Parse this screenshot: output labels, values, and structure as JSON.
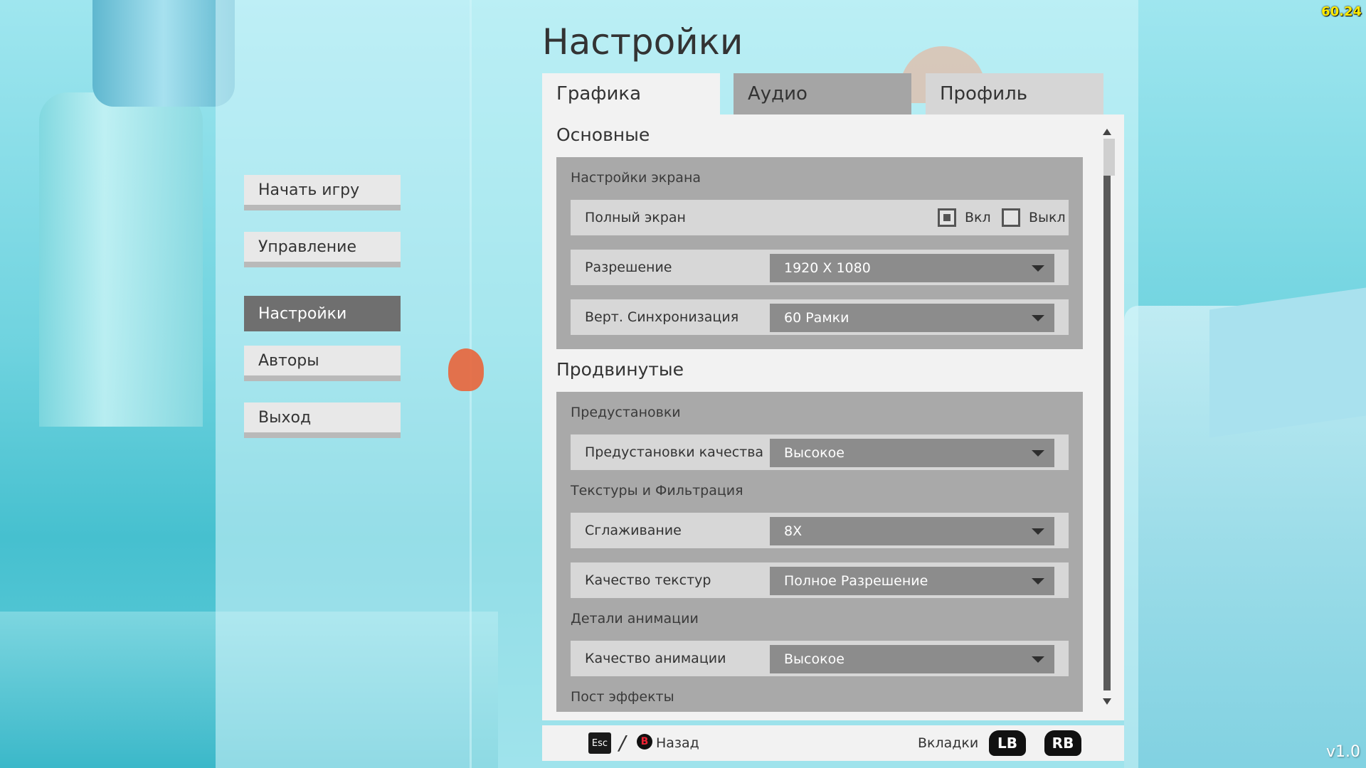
{
  "hud": {
    "fps": "60.24",
    "version": "v1.0"
  },
  "menu": {
    "items": [
      {
        "label": "Начать игру"
      },
      {
        "label": "Управление"
      },
      {
        "label": "Настройки"
      },
      {
        "label": "Авторы"
      },
      {
        "label": "Выход"
      }
    ],
    "active_index": 2
  },
  "settings": {
    "title": "Настройки",
    "tabs": [
      {
        "label": "Графика"
      },
      {
        "label": "Аудио"
      },
      {
        "label": "Профиль"
      }
    ],
    "active_tab": 0,
    "basic": {
      "title": "Основные",
      "screen_group": "Настройки экрана",
      "fullscreen": {
        "label": "Полный экран",
        "on_label": "Вкл",
        "off_label": "Выкл",
        "value": "on"
      },
      "resolution": {
        "label": "Разрешение",
        "value": "1920 X 1080"
      },
      "vsync": {
        "label": "Верт. Синхронизация",
        "value": "60 Рамки"
      }
    },
    "advanced": {
      "title": "Продвинутые",
      "presets_group": "Предустановки",
      "quality_preset": {
        "label": "Предустановки качества",
        "value": "Высокое"
      },
      "textures_group": "Текстуры и Фильтрация",
      "antialiasing": {
        "label": "Сглаживание",
        "value": "8X"
      },
      "texture_quality": {
        "label": "Качество текстур",
        "value": "Полное Разрешение"
      },
      "animation_group": "Детали анимации",
      "animation_quality": {
        "label": "Качество анимации",
        "value": "Высокое"
      },
      "post_group": "Пост эффекты"
    },
    "scroll_position": 0
  },
  "footer": {
    "esc_key": "Esc",
    "separator": "/",
    "b_key": "B",
    "back_label": "Назад",
    "tabs_label": "Вкладки",
    "lb_key": "LB",
    "rb_key": "RB"
  },
  "colors": {
    "panel": "#f2f2f2",
    "group": "#a9a9a9",
    "row": "#d7d7d7",
    "dropdown": "#8c8c8c",
    "active_menu": "#6f6f6f",
    "fps": "#ffea00"
  }
}
